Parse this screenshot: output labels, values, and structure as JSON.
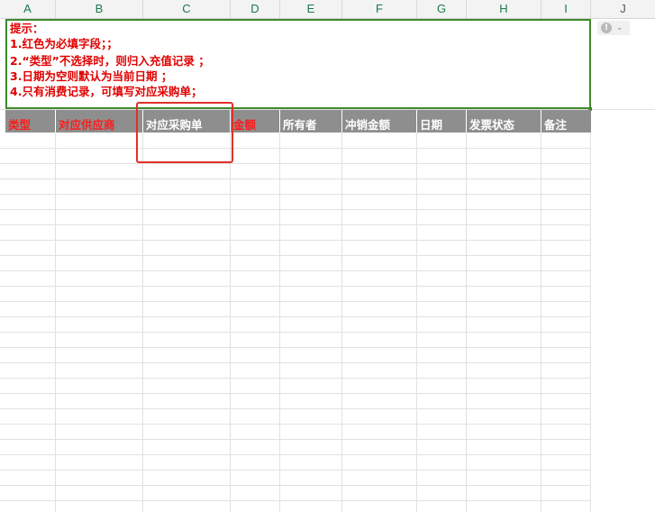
{
  "columns": [
    "A",
    "B",
    "C",
    "D",
    "E",
    "F",
    "G",
    "H",
    "I",
    "J"
  ],
  "note": {
    "lines": [
      "提示：",
      "1.红色为必填字段；；",
      "2.“类型”不选择时，则归入充值记录 ；",
      "3.日期为空则默认为当前日期 ；",
      "4.只有消费记录，可填写对应采购单；"
    ]
  },
  "header_row": {
    "cells": [
      {
        "label": "类型",
        "required": true
      },
      {
        "label": "对应供应商",
        "required": true
      },
      {
        "label": "对应采购单",
        "required": false
      },
      {
        "label": "金额",
        "required": true
      },
      {
        "label": "所有者",
        "required": false
      },
      {
        "label": "冲销金额",
        "required": false
      },
      {
        "label": "日期",
        "required": false
      },
      {
        "label": "发票状态",
        "required": false
      },
      {
        "label": "备注",
        "required": false
      }
    ]
  },
  "warning_button": {
    "icon": "exclamation-icon",
    "chevron": "chevron-down-icon"
  },
  "colors": {
    "required": "#ff1a1a",
    "header_bg": "#8e8e8e",
    "note_border": "#3e8a2b",
    "note_text": "#e00000",
    "highlight": "#e0302b"
  }
}
